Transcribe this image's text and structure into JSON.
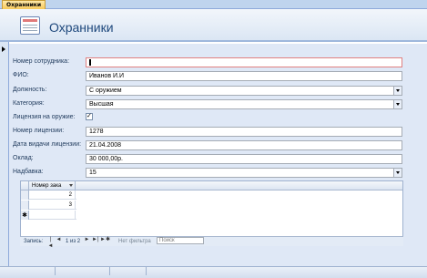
{
  "tab": {
    "label": "Охранники"
  },
  "header": {
    "title": "Охранники"
  },
  "form": {
    "employee_number": {
      "label": "Номер сотрудника:",
      "value": "1"
    },
    "fio": {
      "label": "ФИО:",
      "value": "Иванов И.И"
    },
    "position": {
      "label": "Должность:",
      "value": "С оружием"
    },
    "category": {
      "label": "Категория:",
      "value": "Высшая"
    },
    "weapon_license": {
      "label": "Лицензия на оружие:",
      "checked": true
    },
    "license_number": {
      "label": "Номер лицензии:",
      "value": "1278"
    },
    "license_date": {
      "label": "Дата видачи лицензии:",
      "value": "21.04.2008"
    },
    "salary": {
      "label": "Оклад:",
      "value": "30 000,00р."
    },
    "bonus": {
      "label": "Надбавка:",
      "value": "15"
    }
  },
  "subform": {
    "column_header": "Номер зака",
    "rows": [
      "2",
      "3"
    ],
    "new_row_marker": "✱"
  },
  "navigation": {
    "record_label": "Запись:",
    "first": "|◄",
    "prev": "◄",
    "position": "1 из 2",
    "next": "►",
    "last": "►|",
    "new": "►✱",
    "filter": "Нет фильтра",
    "search": "Поиск"
  }
}
